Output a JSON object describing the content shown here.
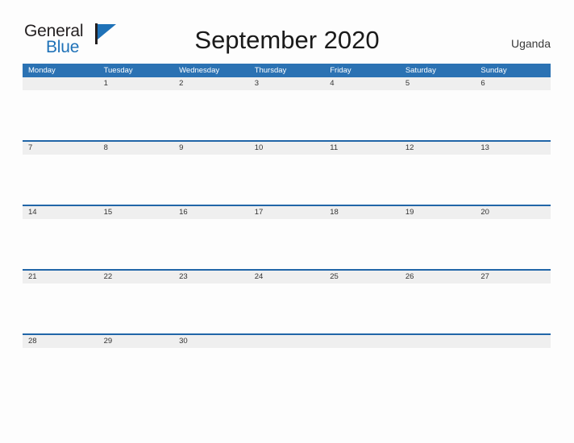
{
  "brand": {
    "name_part1": "General",
    "name_part2": "Blue",
    "flag_icon": "flag-triangle-icon",
    "color_dark": "#231f20",
    "color_blue": "#1f72b8"
  },
  "header": {
    "title": "September 2020",
    "country": "Uganda"
  },
  "calendar": {
    "accent_color": "#2b72b3",
    "rule_color": "#2166a8",
    "date_band_color": "#efefef",
    "day_headers": [
      "Monday",
      "Tuesday",
      "Wednesday",
      "Thursday",
      "Friday",
      "Saturday",
      "Sunday"
    ],
    "weeks": [
      {
        "dates": [
          "",
          "1",
          "2",
          "3",
          "4",
          "5",
          "6"
        ]
      },
      {
        "dates": [
          "7",
          "8",
          "9",
          "10",
          "11",
          "12",
          "13"
        ]
      },
      {
        "dates": [
          "14",
          "15",
          "16",
          "17",
          "18",
          "19",
          "20"
        ]
      },
      {
        "dates": [
          "21",
          "22",
          "23",
          "24",
          "25",
          "26",
          "27"
        ]
      },
      {
        "dates": [
          "28",
          "29",
          "30",
          "",
          "",
          "",
          ""
        ]
      }
    ]
  }
}
